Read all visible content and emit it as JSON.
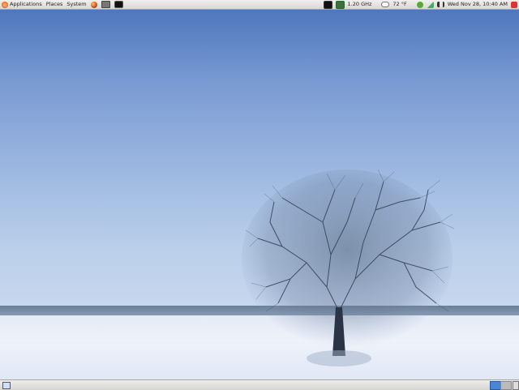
{
  "top_panel": {
    "menus": [
      "Applications",
      "Places",
      "System"
    ],
    "launchers": [
      "firefox-icon",
      "mail-icon",
      "terminal-icon"
    ],
    "cpu_freq": "1.20 GHz",
    "temperature": "72 °F",
    "clock": "Wed Nov 28, 10:40 AM"
  },
  "bottom_panel": {
    "workspaces": 2,
    "active_workspace": 1
  },
  "desktop": {
    "wallpaper": "snowy tree on frozen lake"
  }
}
